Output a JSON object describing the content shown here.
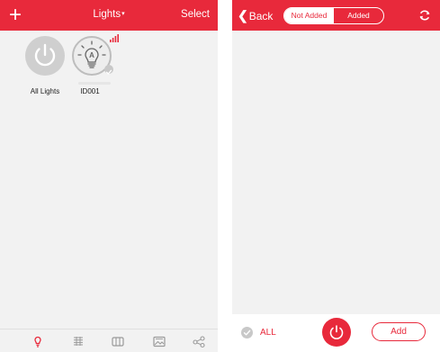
{
  "colors": {
    "accent": "#e8293b",
    "background": "#f2f2f2",
    "inactive_icon": "#9a9a9a"
  },
  "left_screen": {
    "navbar": {
      "add_icon": "plus-icon",
      "title": "Lights",
      "title_caret": "▾",
      "select_label": "Select"
    },
    "tiles": [
      {
        "label": "All Lights",
        "icon": "power-icon"
      },
      {
        "label": "ID001",
        "icon": "bulb-icon",
        "status_icon": "signal-icon",
        "selected": true
      }
    ],
    "tabbar": {
      "items": [
        {
          "icon": "bulb-tab-icon",
          "active": true
        },
        {
          "icon": "list-tab-icon",
          "active": false
        },
        {
          "icon": "panel-tab-icon",
          "active": false
        },
        {
          "icon": "image-tab-icon",
          "active": false
        },
        {
          "icon": "share-tab-icon",
          "active": false
        }
      ]
    }
  },
  "right_screen": {
    "navbar": {
      "back_label": "Back",
      "back_chevron": "❮",
      "segments": [
        {
          "label": "Not Added",
          "selected": true
        },
        {
          "label": "Added",
          "selected": false
        }
      ],
      "refresh_icon": "refresh-icon"
    },
    "bottombar": {
      "all_label": "ALL",
      "power_icon": "power-icon",
      "add_label": "Add"
    }
  }
}
